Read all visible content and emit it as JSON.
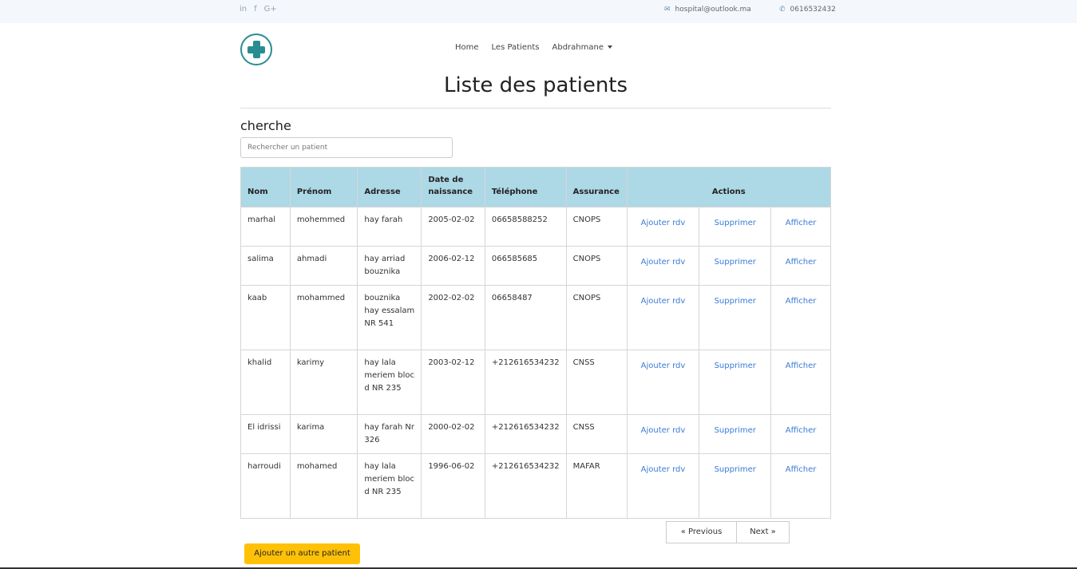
{
  "topbar": {
    "social": [
      "in",
      "f",
      "G+"
    ],
    "email": "hospital@outlook.ma",
    "phone": "0616532432"
  },
  "nav": {
    "home": "Home",
    "patients": "Les Patients",
    "user": "Abdrahmane"
  },
  "page": {
    "title": "Liste des patients",
    "search_label": "cherche",
    "search_placeholder": "Rechercher un patient"
  },
  "table": {
    "headers": [
      "Nom",
      "Prénom",
      "Adresse",
      "Date de naissance",
      "Téléphone",
      "Assurance",
      "Actions"
    ],
    "rows": [
      {
        "nom": "marhal",
        "prenom": "mohemmed",
        "adresse": "hay farah",
        "date": "2005-02-02",
        "tel": "06658588252",
        "assurance": "CNOPS"
      },
      {
        "nom": "salima",
        "prenom": "ahmadi",
        "adresse": "hay arriad bouznika",
        "date": "2006-02-12",
        "tel": "066585685",
        "assurance": "CNOPS"
      },
      {
        "nom": "kaab",
        "prenom": "mohammed",
        "adresse": "bouznika hay essalam NR 541",
        "date": "2002-02-02",
        "tel": "06658487",
        "assurance": "CNOPS"
      },
      {
        "nom": "khalid",
        "prenom": "karimy",
        "adresse": "hay lala meriem bloc d NR 235",
        "date": "2003-02-12",
        "tel": "+212616534232",
        "assurance": "CNSS"
      },
      {
        "nom": "El idrissi",
        "prenom": "karima",
        "adresse": "hay farah Nr 326",
        "date": "2000-02-02",
        "tel": "+212616534232",
        "assurance": "CNSS"
      },
      {
        "nom": "harroudi",
        "prenom": "mohamed",
        "adresse": "hay lala meriem bloc d NR 235",
        "date": "1996-06-02",
        "tel": "+212616534232",
        "assurance": "MAFAR"
      }
    ],
    "actions": {
      "rdv": "Ajouter rdv",
      "delete": "Supprimer",
      "show": "Afficher"
    }
  },
  "pagination": {
    "prev": "« Previous",
    "next": "Next »"
  },
  "add_button": "Ajouter un autre patient",
  "colors": {
    "header_bg": "#add8e6",
    "link": "#3a7bd5",
    "add_button": "#ffc107",
    "logo": "#2a8c93"
  }
}
